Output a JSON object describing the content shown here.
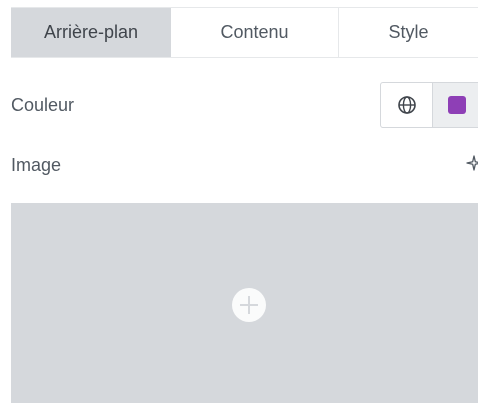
{
  "tabs": [
    {
      "label": "Arrière-plan",
      "active": true
    },
    {
      "label": "Contenu",
      "active": false
    },
    {
      "label": "Style",
      "active": false
    }
  ],
  "color_field": {
    "label": "Couleur",
    "global_icon": "globe-icon",
    "swatch_color": "#8e3fb6"
  },
  "image_field": {
    "label": "Image",
    "ai_icon": "sparkle-icon",
    "add_icon": "plus-circle-icon"
  }
}
